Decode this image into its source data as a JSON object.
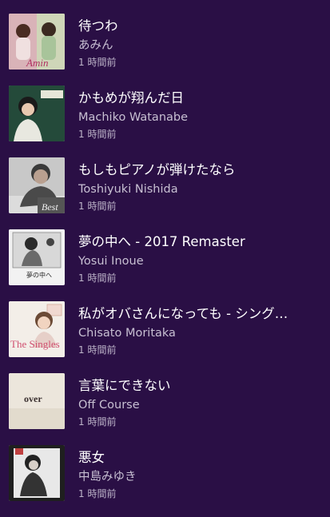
{
  "history": {
    "items": [
      {
        "title": "待つわ",
        "artist": "あみん",
        "time": "1 時間前",
        "cover_icon": "album-cover-amin",
        "cover_text": "Amin"
      },
      {
        "title": "かもめが翔んだ日",
        "artist": "Machiko Watanabe",
        "time": "1 時間前",
        "cover_icon": "album-cover-machiko-watanabe"
      },
      {
        "title": "もしもピアノが弾けたなら",
        "artist": "Toshiyuki Nishida",
        "time": "1 時間前",
        "cover_icon": "album-cover-toshiyuki-nishida",
        "cover_text": "Best"
      },
      {
        "title": "夢の中へ - 2017 Remaster",
        "artist": "Yosui Inoue",
        "time": "1 時間前",
        "cover_icon": "album-cover-yosui-inoue",
        "cover_text": "夢の中へ"
      },
      {
        "title": "私がオバさんになっても - シング…",
        "artist": "Chisato Moritaka",
        "time": "1 時間前",
        "cover_icon": "album-cover-chisato-moritaka",
        "cover_text": "The Singles"
      },
      {
        "title": "言葉にできない",
        "artist": "Off Course",
        "time": "1 時間前",
        "cover_icon": "album-cover-off-course",
        "cover_text": "over"
      },
      {
        "title": "悪女",
        "artist": "中島みゆき",
        "time": "1 時間前",
        "cover_icon": "album-cover-miyuki-nakajima"
      }
    ]
  }
}
